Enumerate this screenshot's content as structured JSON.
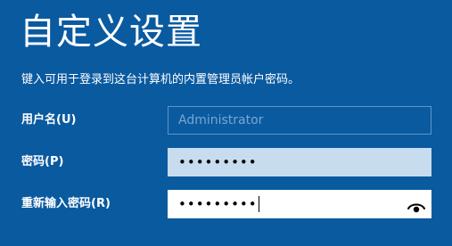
{
  "header": {
    "title": "自定义设置",
    "description": "键入可用于登录到这台计算机的内置管理员帐户密码。"
  },
  "form": {
    "username": {
      "label": "用户名(U)",
      "placeholder": "Administrator"
    },
    "password": {
      "label": "密码(P)",
      "masked_value": "•••••••••"
    },
    "confirm_password": {
      "label": "重新输入密码(R)",
      "masked_value": "•••••••••",
      "reveal_icon": "eye-icon"
    }
  },
  "colors": {
    "background": "#0a5aa0",
    "text": "#ffffff",
    "field_filled": "#c7dcee",
    "field_active": "#ffffff",
    "disabled_border": "#5f95c7"
  }
}
